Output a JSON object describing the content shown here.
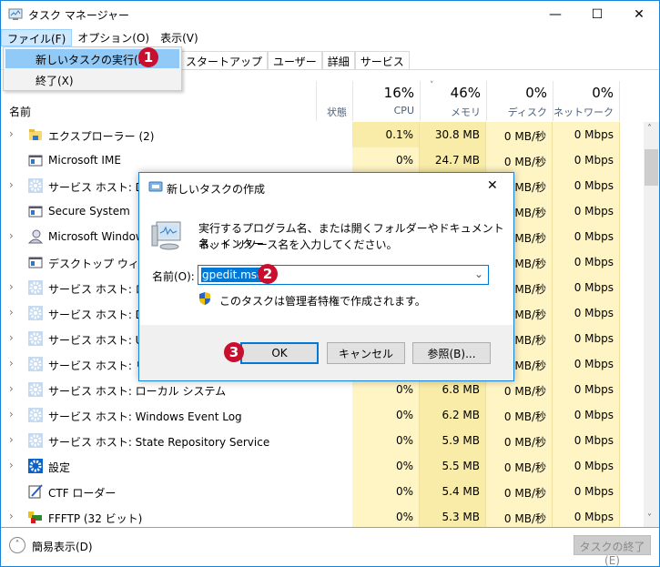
{
  "window": {
    "title": "タスク マネージャー",
    "minimize": "—",
    "maximize": "☐",
    "close": "✕"
  },
  "menu": [
    "ファイル(F)",
    "オプション(O)",
    "表示(V)"
  ],
  "file_menu": {
    "items": [
      "新しいタスクの実行(N)",
      "終了(X)"
    ]
  },
  "tabs": [
    "スタートアップ",
    "ユーザー",
    "詳細",
    "サービス"
  ],
  "columns": {
    "name": "名前",
    "status": "状態",
    "cpu": {
      "pct": "16%",
      "label": "CPU"
    },
    "memory": {
      "pct": "46%",
      "label": "メモリ"
    },
    "disk": {
      "pct": "0%",
      "label": "ディスク"
    },
    "network": {
      "pct": "0%",
      "label": "ネットワーク"
    }
  },
  "processes": [
    {
      "name": "エクスプローラー (2)",
      "icon": "folder-icon",
      "expand": true,
      "cpu": "0.1%",
      "mem": "30.8 MB",
      "disk": "0 MB/秒",
      "net": "0 Mbps"
    },
    {
      "name": "Microsoft IME",
      "icon": "app-window-icon",
      "expand": false,
      "cpu": "0%",
      "mem": "24.7 MB",
      "disk": "0 MB/秒",
      "net": "0 Mbps"
    },
    {
      "name": "サービス ホスト: Diagr",
      "icon": "gear-icon",
      "expand": true,
      "cpu": "",
      "mem": "",
      "disk": "0 MB/秒",
      "net": "0 Mbps"
    },
    {
      "name": "Secure System",
      "icon": "app-window-icon",
      "expand": false,
      "cpu": "",
      "mem": "",
      "disk": "0 MB/秒",
      "net": "0 Mbps"
    },
    {
      "name": "Microsoft Windows",
      "icon": "user-icon",
      "expand": true,
      "cpu": "",
      "mem": "",
      "disk": "0 MB/秒",
      "net": "0 Mbps"
    },
    {
      "name": "デスクトップ ウィンドウ",
      "icon": "app-window-icon",
      "expand": false,
      "cpu": "",
      "mem": "",
      "disk": "0 MB/秒",
      "net": "0 Mbps"
    },
    {
      "name": "サービス ホスト: ローカ",
      "icon": "gear-icon",
      "expand": true,
      "cpu": "",
      "mem": "",
      "disk": "0 MB/秒",
      "net": "0 Mbps"
    },
    {
      "name": "サービス ホスト: DCOM",
      "icon": "gear-icon",
      "expand": true,
      "cpu": "",
      "mem": "",
      "disk": "0 MB/秒",
      "net": "0 Mbps"
    },
    {
      "name": "サービス ホスト: UtcSv",
      "icon": "gear-icon",
      "expand": true,
      "cpu": "",
      "mem": "",
      "disk": "0 MB/秒",
      "net": "0 Mbps"
    },
    {
      "name": "サービス ホスト: リモー",
      "icon": "gear-icon",
      "expand": true,
      "cpu": "",
      "mem": "",
      "disk": "0 MB/秒",
      "net": "0 Mbps"
    },
    {
      "name": "サービス ホスト: ローカル システム",
      "icon": "gear-icon",
      "expand": true,
      "cpu": "0%",
      "mem": "6.8 MB",
      "disk": "0 MB/秒",
      "net": "0 Mbps"
    },
    {
      "name": "サービス ホスト: Windows Event Log",
      "icon": "gear-icon",
      "expand": true,
      "cpu": "0%",
      "mem": "6.2 MB",
      "disk": "0 MB/秒",
      "net": "0 Mbps"
    },
    {
      "name": "サービス ホスト: State Repository Service",
      "icon": "gear-icon",
      "expand": true,
      "cpu": "0%",
      "mem": "5.9 MB",
      "disk": "0 MB/秒",
      "net": "0 Mbps"
    },
    {
      "name": "設定",
      "icon": "settings-icon",
      "expand": true,
      "cpu": "0%",
      "mem": "5.5 MB",
      "disk": "0 MB/秒",
      "net": "0 Mbps"
    },
    {
      "name": "CTF ローダー",
      "icon": "pen-icon",
      "expand": false,
      "cpu": "0%",
      "mem": "5.4 MB",
      "disk": "0 MB/秒",
      "net": "0 Mbps"
    },
    {
      "name": "FFFTP (32 ビット)",
      "icon": "ftp-icon",
      "expand": true,
      "cpu": "0%",
      "mem": "5.3 MB",
      "disk": "0 MB/秒",
      "net": "0 Mbps"
    }
  ],
  "footer": {
    "fewer_details": "簡易表示(D)",
    "end_task": "タスクの終了(E)"
  },
  "dialog": {
    "title": "新しいタスクの作成",
    "close": "✕",
    "description_line1": "実行するプログラム名、または開くフォルダーやドキュメント名、インター",
    "description_line2": "ネット リソース名を入力してください。",
    "name_label": "名前(O):",
    "input_value": "gpedit.msc",
    "admin_note": "このタスクは管理者特権で作成されます。",
    "ok": "OK",
    "cancel": "キャンセル",
    "browse": "参照(B)..."
  },
  "badges": [
    "1",
    "2",
    "3"
  ],
  "colors": {
    "accent": "#0078d7",
    "badge": "#c8102e",
    "highlight": "#91c9f7",
    "heat_light": "#fff4c4",
    "heat_dark": "#f9eca8"
  }
}
